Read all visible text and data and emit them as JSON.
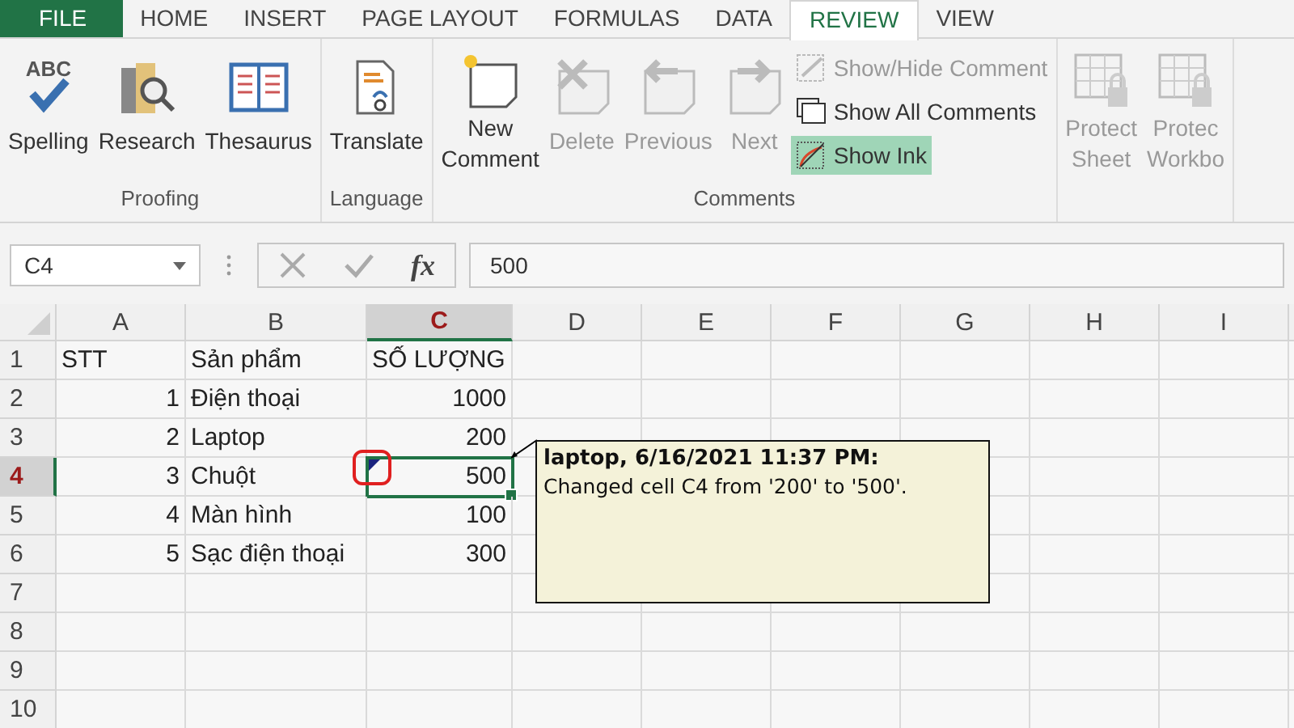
{
  "tabs": [
    {
      "label": "FILE",
      "kind": "file",
      "selected": false
    },
    {
      "label": "HOME",
      "kind": "tab",
      "selected": false
    },
    {
      "label": "INSERT",
      "kind": "tab",
      "selected": false
    },
    {
      "label": "PAGE LAYOUT",
      "kind": "tab",
      "selected": false
    },
    {
      "label": "FORMULAS",
      "kind": "tab",
      "selected": false
    },
    {
      "label": "DATA",
      "kind": "tab",
      "selected": false
    },
    {
      "label": "REVIEW",
      "kind": "tab",
      "selected": true
    },
    {
      "label": "VIEW",
      "kind": "tab",
      "selected": false
    }
  ],
  "ribbon_groups": [
    {
      "label": "Proofing",
      "buttons": [
        {
          "kind": "large",
          "lines": [
            "Spelling"
          ],
          "icon_text": "ABC",
          "disabled": false
        },
        {
          "kind": "large",
          "lines": [
            "Research"
          ],
          "disabled": false
        },
        {
          "kind": "large",
          "lines": [
            "Thesaurus"
          ],
          "disabled": false
        }
      ]
    },
    {
      "label": "Language",
      "buttons": [
        {
          "kind": "large",
          "lines": [
            "Translate"
          ],
          "disabled": false
        }
      ]
    },
    {
      "label": "Comments",
      "buttons": [
        {
          "kind": "large",
          "lines": [
            "New",
            "Comment"
          ],
          "disabled": false
        },
        {
          "kind": "large",
          "lines": [
            "Delete"
          ],
          "disabled": true
        },
        {
          "kind": "large",
          "lines": [
            "Previous"
          ],
          "disabled": true
        },
        {
          "kind": "large",
          "lines": [
            "Next"
          ],
          "disabled": true
        },
        {
          "kind": "small",
          "lines": [
            "Show/Hide Comment"
          ],
          "disabled": true,
          "selected": false
        },
        {
          "kind": "small",
          "lines": [
            "Show All Comments"
          ],
          "disabled": false,
          "selected": false
        },
        {
          "kind": "small",
          "lines": [
            "Show Ink"
          ],
          "disabled": false,
          "selected": true
        }
      ]
    },
    {
      "buttons": [
        {
          "kind": "large",
          "lines": [
            "Protect",
            "Sheet"
          ],
          "disabled": true
        },
        {
          "kind": "large",
          "lines": [
            "Protec",
            "Workbo"
          ],
          "disabled": true
        }
      ]
    }
  ],
  "formula_bar": {
    "name_box": "C4",
    "fx_symbol": "fx",
    "value": "500"
  },
  "sheet": {
    "columns": [
      {
        "label": "A",
        "selected": false
      },
      {
        "label": "B",
        "selected": false
      },
      {
        "label": "C",
        "selected": true
      },
      {
        "label": "D",
        "selected": false
      },
      {
        "label": "E",
        "selected": false
      },
      {
        "label": "F",
        "selected": false
      },
      {
        "label": "G",
        "selected": false
      },
      {
        "label": "H",
        "selected": false
      },
      {
        "label": "I",
        "selected": false
      }
    ],
    "rows": [
      {
        "number": "1",
        "selected": false,
        "cells": [
          {
            "text": "STT",
            "kind": "text"
          },
          {
            "text": "Sản phẩm",
            "kind": "text"
          },
          {
            "text": "SỐ LƯỢNG",
            "kind": "text"
          }
        ]
      },
      {
        "number": "2",
        "selected": false,
        "cells": [
          {
            "text": "1",
            "kind": "number"
          },
          {
            "text": "Điện thoại",
            "kind": "text"
          },
          {
            "text": "1000",
            "kind": "number"
          }
        ]
      },
      {
        "number": "3",
        "selected": false,
        "cells": [
          {
            "text": "2",
            "kind": "number"
          },
          {
            "text": "Laptop",
            "kind": "text"
          },
          {
            "text": "200",
            "kind": "number"
          }
        ]
      },
      {
        "number": "4",
        "selected": true,
        "cells": [
          {
            "text": "3",
            "kind": "number"
          },
          {
            "text": "Chuột",
            "kind": "text"
          },
          {
            "text": "500",
            "kind": "number",
            "active": true,
            "has_comment": true
          }
        ]
      },
      {
        "number": "5",
        "selected": false,
        "cells": [
          {
            "text": "4",
            "kind": "number"
          },
          {
            "text": "Màn hình",
            "kind": "text"
          },
          {
            "text": "100",
            "kind": "number"
          }
        ]
      },
      {
        "number": "6",
        "selected": false,
        "cells": [
          {
            "text": "5",
            "kind": "number"
          },
          {
            "text": "Sạc điện thoại",
            "kind": "text"
          },
          {
            "text": "300",
            "kind": "number"
          }
        ]
      },
      {
        "number": "7",
        "selected": false,
        "cells": []
      },
      {
        "number": "8",
        "selected": false,
        "cells": []
      },
      {
        "number": "9",
        "selected": false,
        "cells": []
      },
      {
        "number": "10",
        "selected": false,
        "cells": []
      }
    ]
  },
  "comment": {
    "author": "laptop, 6/16/2021 11:37 PM:",
    "text": "Changed cell C4 from '200' to '500'."
  }
}
